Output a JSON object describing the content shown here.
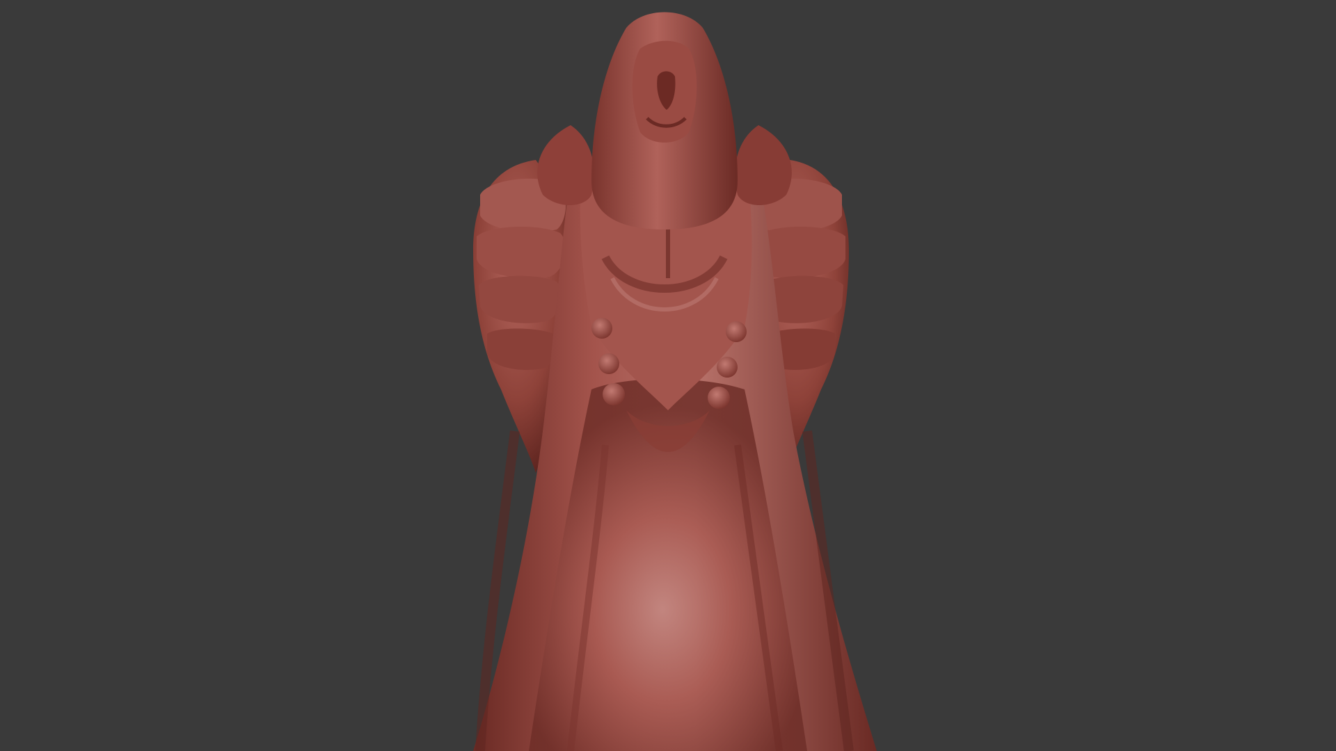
{
  "viewport": {
    "background_color": "#3a3a3a",
    "model": {
      "name": "sculpted-robed-figure",
      "material_color": "#9a4a42",
      "material_highlight": "#c98a84",
      "material_shadow": "#5e2621"
    }
  }
}
